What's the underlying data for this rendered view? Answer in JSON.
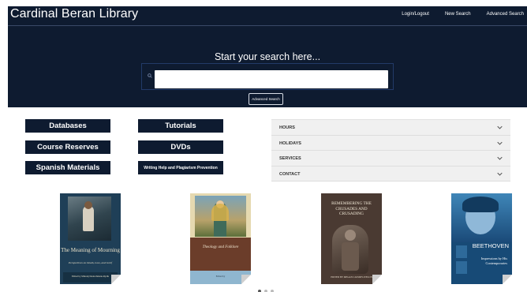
{
  "header": {
    "title": "Cardinal Beran Library",
    "nav": [
      "Login/Logout",
      "New Search",
      "Advanced Search"
    ]
  },
  "search": {
    "heading": "Start your search here...",
    "placeholder": "",
    "advanced_button": "Advanced Search"
  },
  "quick_links": [
    "Databases",
    "Tutorials",
    "Course Reserves",
    "DVDs",
    "Spanish Materials",
    "Writing Help and Plagiarism Prevention"
  ],
  "accordion": [
    "HOURS",
    "HOLIDAYS",
    "SERVICES",
    "CONTACT"
  ],
  "books": [
    {
      "title": "The Meaning of Mourning",
      "subtitle": "Perspectives on Death, Loss, and Grief",
      "author": "Edited by Mikołaj Deutschmann-Ryzik"
    },
    {
      "title": "Theology and Folklore",
      "subtitle": "",
      "author": "Edited by"
    },
    {
      "title": "REMEMBERING THE CRUSADES AND CRUSADING",
      "subtitle": "",
      "author": "EDITED BY MEGAN CASSIDY-WELCH"
    },
    {
      "title": "BEETHOVEN",
      "subtitle": "Impressions by His Contemporaries",
      "author": ""
    }
  ],
  "colors": {
    "header_bg": "#0e1b30",
    "button_bg": "#0e1b30",
    "accordion_bg": "#f0f0f0"
  },
  "carousel": {
    "pages": 3,
    "active": 1
  }
}
